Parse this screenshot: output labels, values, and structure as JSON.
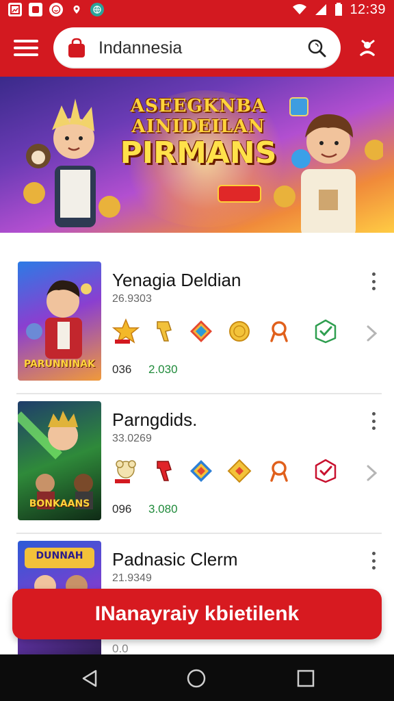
{
  "status_bar": {
    "time": "12:39"
  },
  "header": {
    "search_text": "Indannesia"
  },
  "banner": {
    "line1": "ASEEGKNBA AINIDEILAN",
    "line2": "PIRMANS"
  },
  "items": [
    {
      "title": "Yenagia Deldian",
      "subtitle": "26.9303",
      "thumb_label": "PARUNNINAK",
      "stat1": "036",
      "stat2": "2.030"
    },
    {
      "title": "Parngdids.",
      "subtitle": "33.0269",
      "thumb_label": "BONKAANS",
      "stat1": "096",
      "stat2": "3.080"
    },
    {
      "title": "Padnasic Clerm",
      "subtitle": "21.9349",
      "thumb_label": "DUNNAH",
      "stat1": "0.0",
      "stat2": ""
    }
  ],
  "cta": {
    "label": "INanayraiy kbietilenk"
  },
  "colors": {
    "brand_red": "#d31920",
    "check_green": "#2e9e4f",
    "check_red": "#c8102e"
  }
}
